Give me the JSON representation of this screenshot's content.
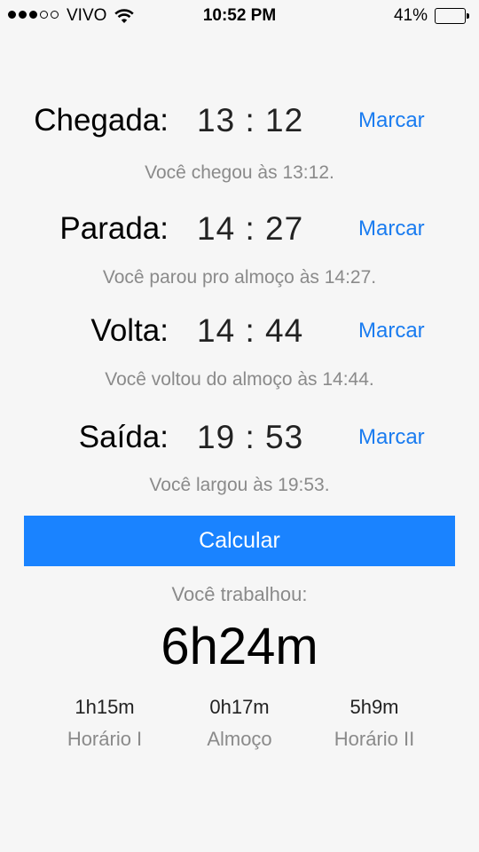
{
  "status_bar": {
    "carrier": "VIVO",
    "signal_bars_filled": 3,
    "signal_bars_total": 5,
    "wifi_icon": "wifi-icon",
    "time": "10:52 PM",
    "battery_percent": "41%",
    "battery_level": 0.41
  },
  "rows": [
    {
      "label": "Chegada:",
      "hour": "13",
      "separator": ":",
      "minute": "12",
      "button": "Marcar",
      "status": "Você chegou às 13:12."
    },
    {
      "label": "Parada:",
      "hour": "14",
      "separator": ":",
      "minute": "27",
      "button": "Marcar",
      "status": "Você parou pro almoço às 14:27."
    },
    {
      "label": "Volta:",
      "hour": "14",
      "separator": ":",
      "minute": "44",
      "button": "Marcar",
      "status": "Você voltou do almoço às 14:44."
    },
    {
      "label": "Saída:",
      "hour": "19",
      "separator": ":",
      "minute": "53",
      "button": "Marcar",
      "status": "Você largou às 19:53."
    }
  ],
  "calculate_button": "Calcular",
  "result": {
    "label": "Você trabalhou:",
    "total": "6h24m",
    "breakdown": [
      {
        "value": "1h15m",
        "label": "Horário I"
      },
      {
        "value": "0h17m",
        "label": "Almoço"
      },
      {
        "value": "5h9m",
        "label": "Horário II"
      }
    ]
  },
  "colors": {
    "accent": "#1a7cf0",
    "button_background": "#1a83ff",
    "secondary_text": "#8a8a8a",
    "background": "#f6f6f6"
  }
}
